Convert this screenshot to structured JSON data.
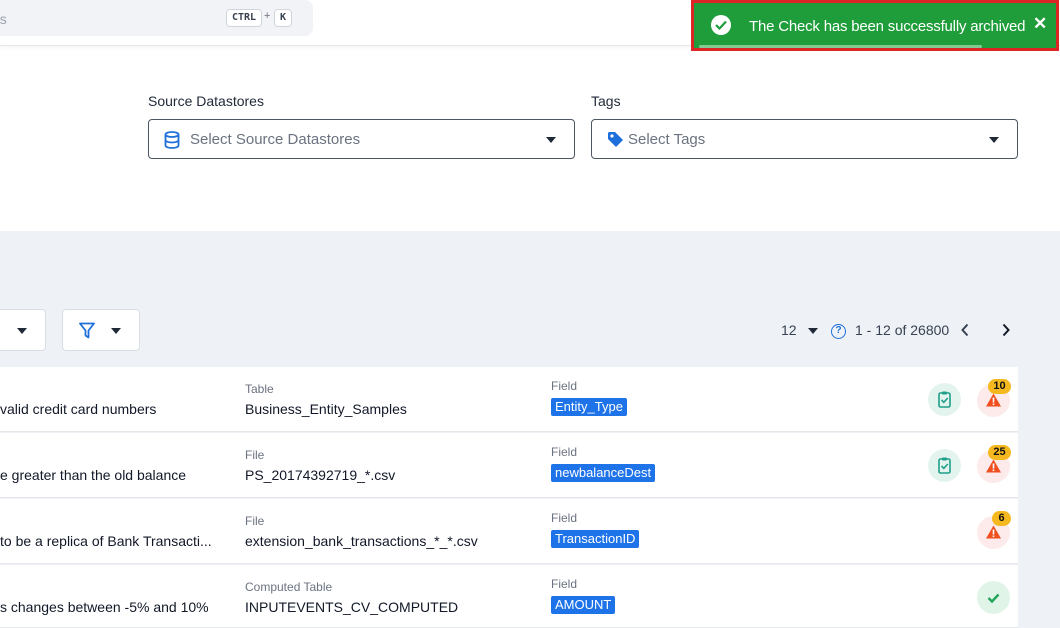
{
  "topbar": {
    "search_placeholder": "ds",
    "shortcut": [
      "CTRL",
      "K"
    ],
    "shortcut_plus": "+"
  },
  "toast": {
    "message": "The Check has been successfully archived",
    "close": "✕",
    "color": "#1f9d3a"
  },
  "filters": {
    "source_datastores": {
      "label": "Source Datastores",
      "placeholder": "Select Source Datastores",
      "icon": "database-icon"
    },
    "tags": {
      "label": "Tags",
      "placeholder": "Select Tags",
      "icon": "tag-icon"
    }
  },
  "toolbar": {
    "filter_icon": "filter-icon",
    "page_size": "12",
    "range": "1 - 12 of 26800",
    "help": "?",
    "prev": "‹",
    "next": "›"
  },
  "checks": [
    {
      "name": "valid credit card numbers",
      "container_type": "Table",
      "container": "Business_Entity_Samples",
      "field_label": "Field",
      "field": "Entity_Type",
      "status_icon": "clipboard-check-icon",
      "anomalies": "10"
    },
    {
      "name": "e greater than the old balance",
      "container_type": "File",
      "container": "PS_20174392719_*.csv",
      "field_label": "Field",
      "field": "newbalanceDest",
      "status_icon": "clipboard-check-icon",
      "anomalies": "25"
    },
    {
      "name": "to be a replica of Bank Transacti...",
      "container_type": "File",
      "container": "extension_bank_transactions_*_*.csv",
      "field_label": "Field",
      "field": "TransactionID",
      "anomalies": "6"
    },
    {
      "name": "s changes between -5% and 10%",
      "container_type": "Computed Table",
      "container": "INPUTEVENTS_CV_COMPUTED",
      "field_label": "Field",
      "field": "AMOUNT",
      "status_icon": "check-icon"
    }
  ]
}
